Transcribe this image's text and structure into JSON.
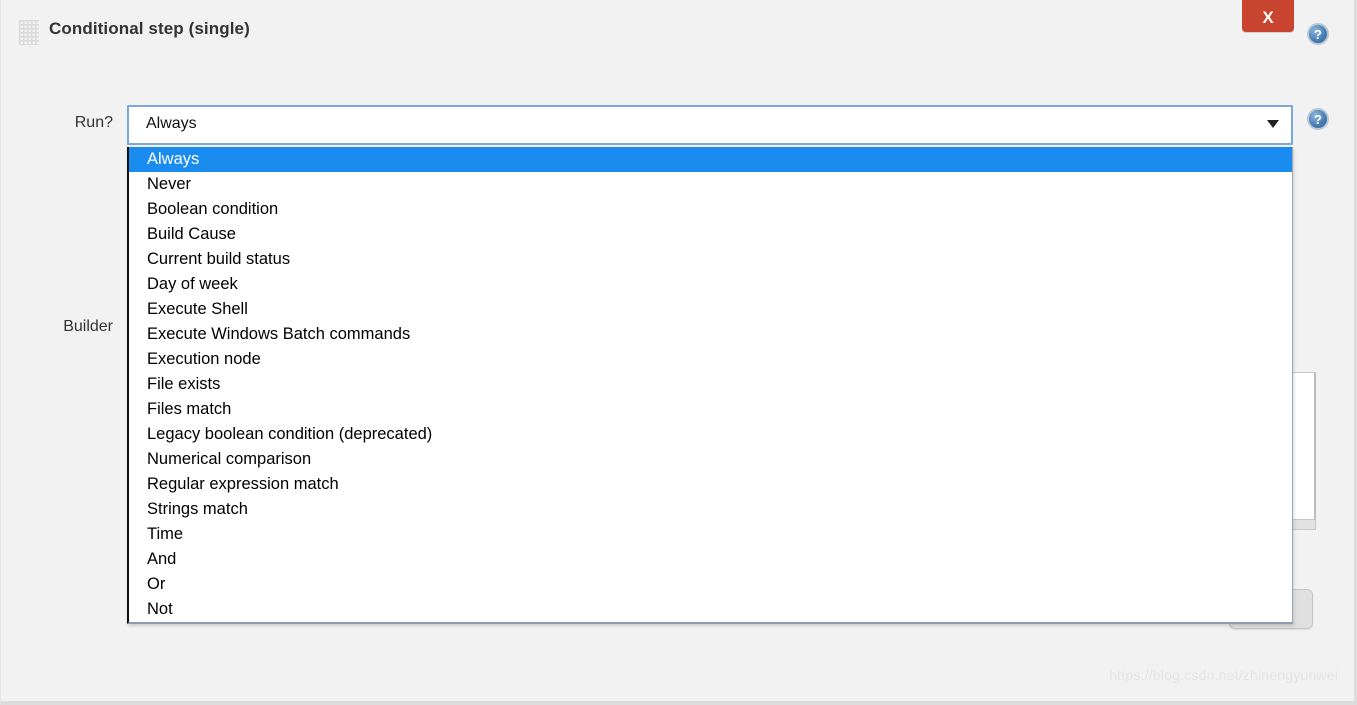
{
  "window": {
    "title": "Conditional step (single)",
    "close_label": "X",
    "help_label": "?",
    "drag_handle_name": "drag-handle"
  },
  "form": {
    "run_label": "Run?",
    "builder_label": "Builder"
  },
  "run_select": {
    "value": "Always",
    "arrow": "▼",
    "expanded": true,
    "selected_index": 0,
    "options": [
      "Always",
      "Never",
      "Boolean condition",
      "Build Cause",
      "Current build status",
      "Day of week",
      "Execute Shell",
      "Execute Windows Batch commands",
      "Execution node",
      "File exists",
      "Files match",
      "Legacy boolean condition (deprecated)",
      "Numerical comparison",
      "Regular expression match",
      "Strings match",
      "Time",
      "And",
      "Or",
      "Not"
    ]
  },
  "builder": {
    "textarea_value": "",
    "action_button_label": ""
  },
  "watermark": {
    "text": "https://blog.csdn.net/zhinengyunwei"
  },
  "colors": {
    "page_background": "#f2f2f2",
    "close_button": "#c9452f",
    "select_focus_border": "#7ba7dd",
    "option_highlight": "#1a8cf0",
    "help_icon": "#4a7fb5",
    "text": "#333333"
  }
}
